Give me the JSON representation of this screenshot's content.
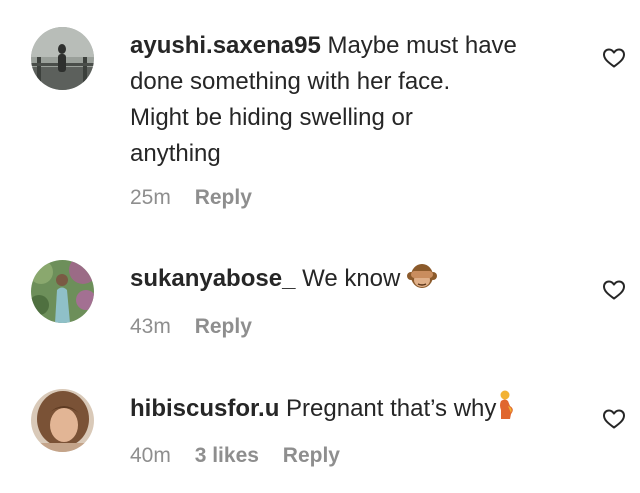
{
  "comments": [
    {
      "username": "ayushi.saxena95",
      "text_lines": [
        "Maybe must have",
        "done something with her face.",
        "Might be hiding swelling or",
        "anything"
      ],
      "time": "25m",
      "reply": "Reply",
      "emoji": "",
      "likes": ""
    },
    {
      "username": "sukanyabose_",
      "text_lines": [
        "We know"
      ],
      "time": "43m",
      "reply": "Reply",
      "emoji": "see-no-evil-monkey-icon",
      "likes": ""
    },
    {
      "username": "hibiscusfor.u",
      "text_lines": [
        "Pregnant that’s why"
      ],
      "time": "40m",
      "reply": "Reply",
      "emoji": "pregnant-woman-icon",
      "likes": "3 likes"
    }
  ],
  "icons": {
    "like": "heart-outline-icon"
  },
  "colors": {
    "text": "#262626",
    "meta": "#8e8e8e"
  }
}
